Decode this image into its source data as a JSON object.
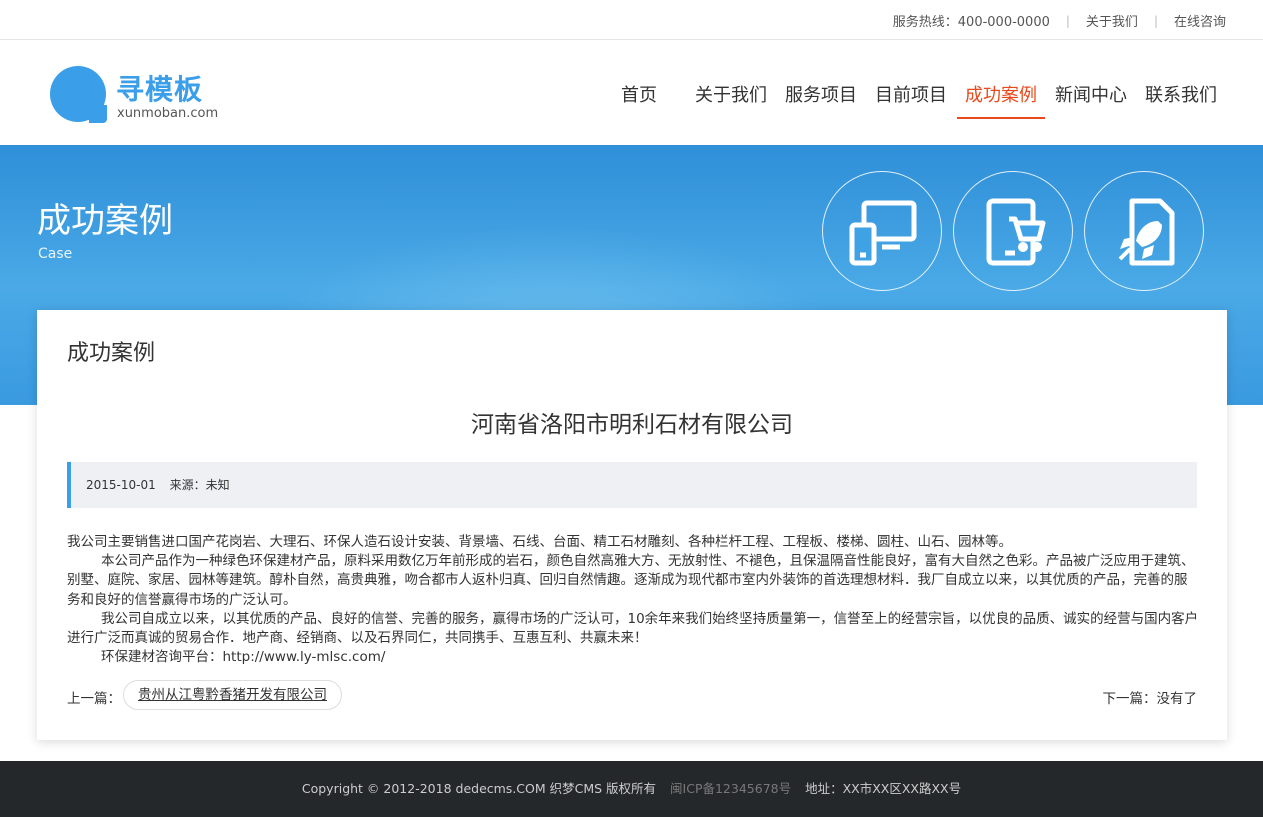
{
  "topbar": {
    "hotline": "服务热线：400-000-0000",
    "about": "关于我们",
    "consult": "在线咨询"
  },
  "logo": {
    "name": "寻模板",
    "domain": "xunmoban.com"
  },
  "nav": {
    "items": [
      {
        "label": "首页"
      },
      {
        "label": "关于我们"
      },
      {
        "label": "服务项目"
      },
      {
        "label": "目前项目"
      },
      {
        "label": "成功案例"
      },
      {
        "label": "新闻中心"
      },
      {
        "label": "联系我们"
      }
    ],
    "active": "成功案例"
  },
  "banner": {
    "title": "成功案例",
    "subtitle": "Case",
    "icons": [
      "devices-icon",
      "tablet-cart-icon",
      "rocket-file-icon"
    ]
  },
  "content": {
    "section_title": "成功案例",
    "article_title": "河南省洛阳市明利石材有限公司",
    "date": "2015-10-01",
    "source": "来源：未知",
    "paragraphs": [
      "我公司主要销售进口国产花岗岩、大理石、环保人造石设计安装、背景墙、石线、台面、精工石材雕刻、各种栏杆工程、工程板、楼梯、圆柱、山石、园林等。",
      "本公司产品作为一种绿色环保建材产品，原料采用数亿万年前形成的岩石，颜色自然高雅大方、无放射性、不褪色，且保温隔音性能良好，富有大自然之色彩。产品被广泛应用于建筑、别墅、庭院、家居、园林等建筑。醇朴自然，高贵典雅，吻合都市人返朴归真、回归自然情趣。逐渐成为现代都市室内外装饰的首选理想材料．我厂自成立以来，以其优质的产品，完善的服务和良好的信誉赢得市场的广泛认可。",
      " 我公司自成立以来，以其优质的产品、良好的信誉、完善的服务，赢得市场的广泛认可，10余年来我们始终坚持质量第一，信誉至上的经营宗旨，以优良的品质、诚实的经营与国内客户进行广泛而真诚的贸易合作．地产商、经销商、以及石界同仁，共同携手、互惠互利、共赢未来！",
      "环保建材咨询平台：http://www.ly-mlsc.com/"
    ],
    "prev_label": "上一篇：",
    "prev_link": "贵州从江粤黔香猪开发有限公司",
    "next_label": "下一篇：没有了"
  },
  "footer": {
    "copyright": "Copyright © 2012-2018 dedecms.COM 织梦CMS 版权所有",
    "icp": "闽ICP备12345678号",
    "address": "地址：XX市XX区XX路XX号"
  },
  "colors": {
    "brand": "#3b9ee8",
    "active_nav": "#e8491d",
    "footer_bg": "#25282b"
  }
}
